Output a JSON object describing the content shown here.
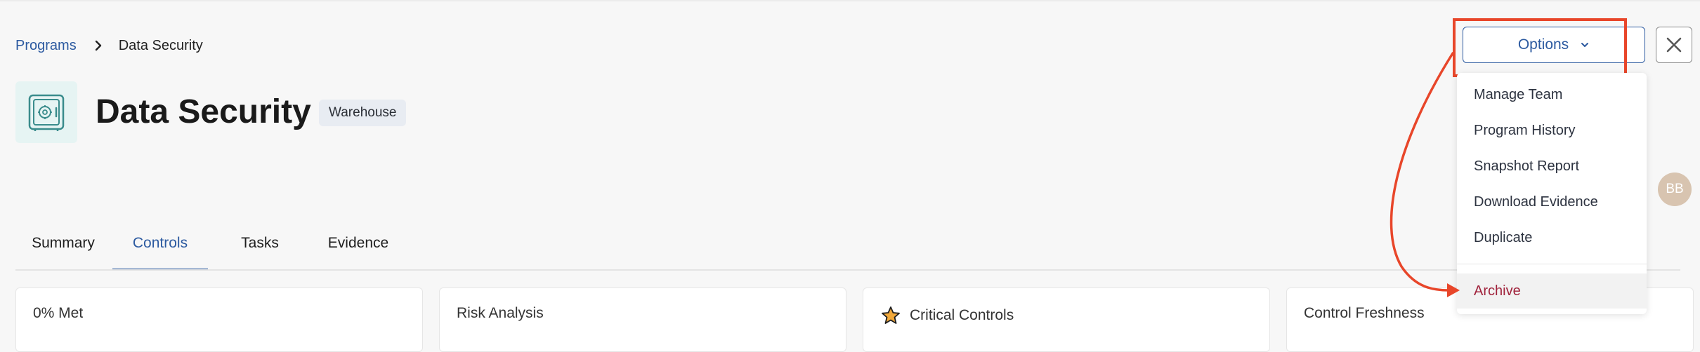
{
  "breadcrumb": {
    "parent": "Programs",
    "current": "Data Security"
  },
  "header": {
    "title": "Data Security",
    "tag": "Warehouse"
  },
  "tabs": [
    {
      "label": "Summary"
    },
    {
      "label": "Controls",
      "active": true
    },
    {
      "label": "Tasks"
    },
    {
      "label": "Evidence"
    }
  ],
  "cards": [
    {
      "title": "0% Met"
    },
    {
      "title": "Risk Analysis"
    },
    {
      "title": "Critical Controls",
      "icon": "star-icon"
    },
    {
      "title": "Control Freshness"
    }
  ],
  "options": {
    "label": "Options",
    "menu": [
      "Manage Team",
      "Program History",
      "Snapshot Report",
      "Download Evidence",
      "Duplicate"
    ],
    "archive": "Archive"
  },
  "avatar": {
    "initials": "BB"
  },
  "colors": {
    "accent": "#2c5aa0",
    "annotation": "#e8462a",
    "archive_text": "#a0223b",
    "icon_teal": "#3a8c8c",
    "star_fill": "#f2a93b"
  },
  "icons": [
    "chevron-right-icon",
    "safe-icon",
    "chevron-down-icon",
    "close-icon",
    "star-icon"
  ]
}
